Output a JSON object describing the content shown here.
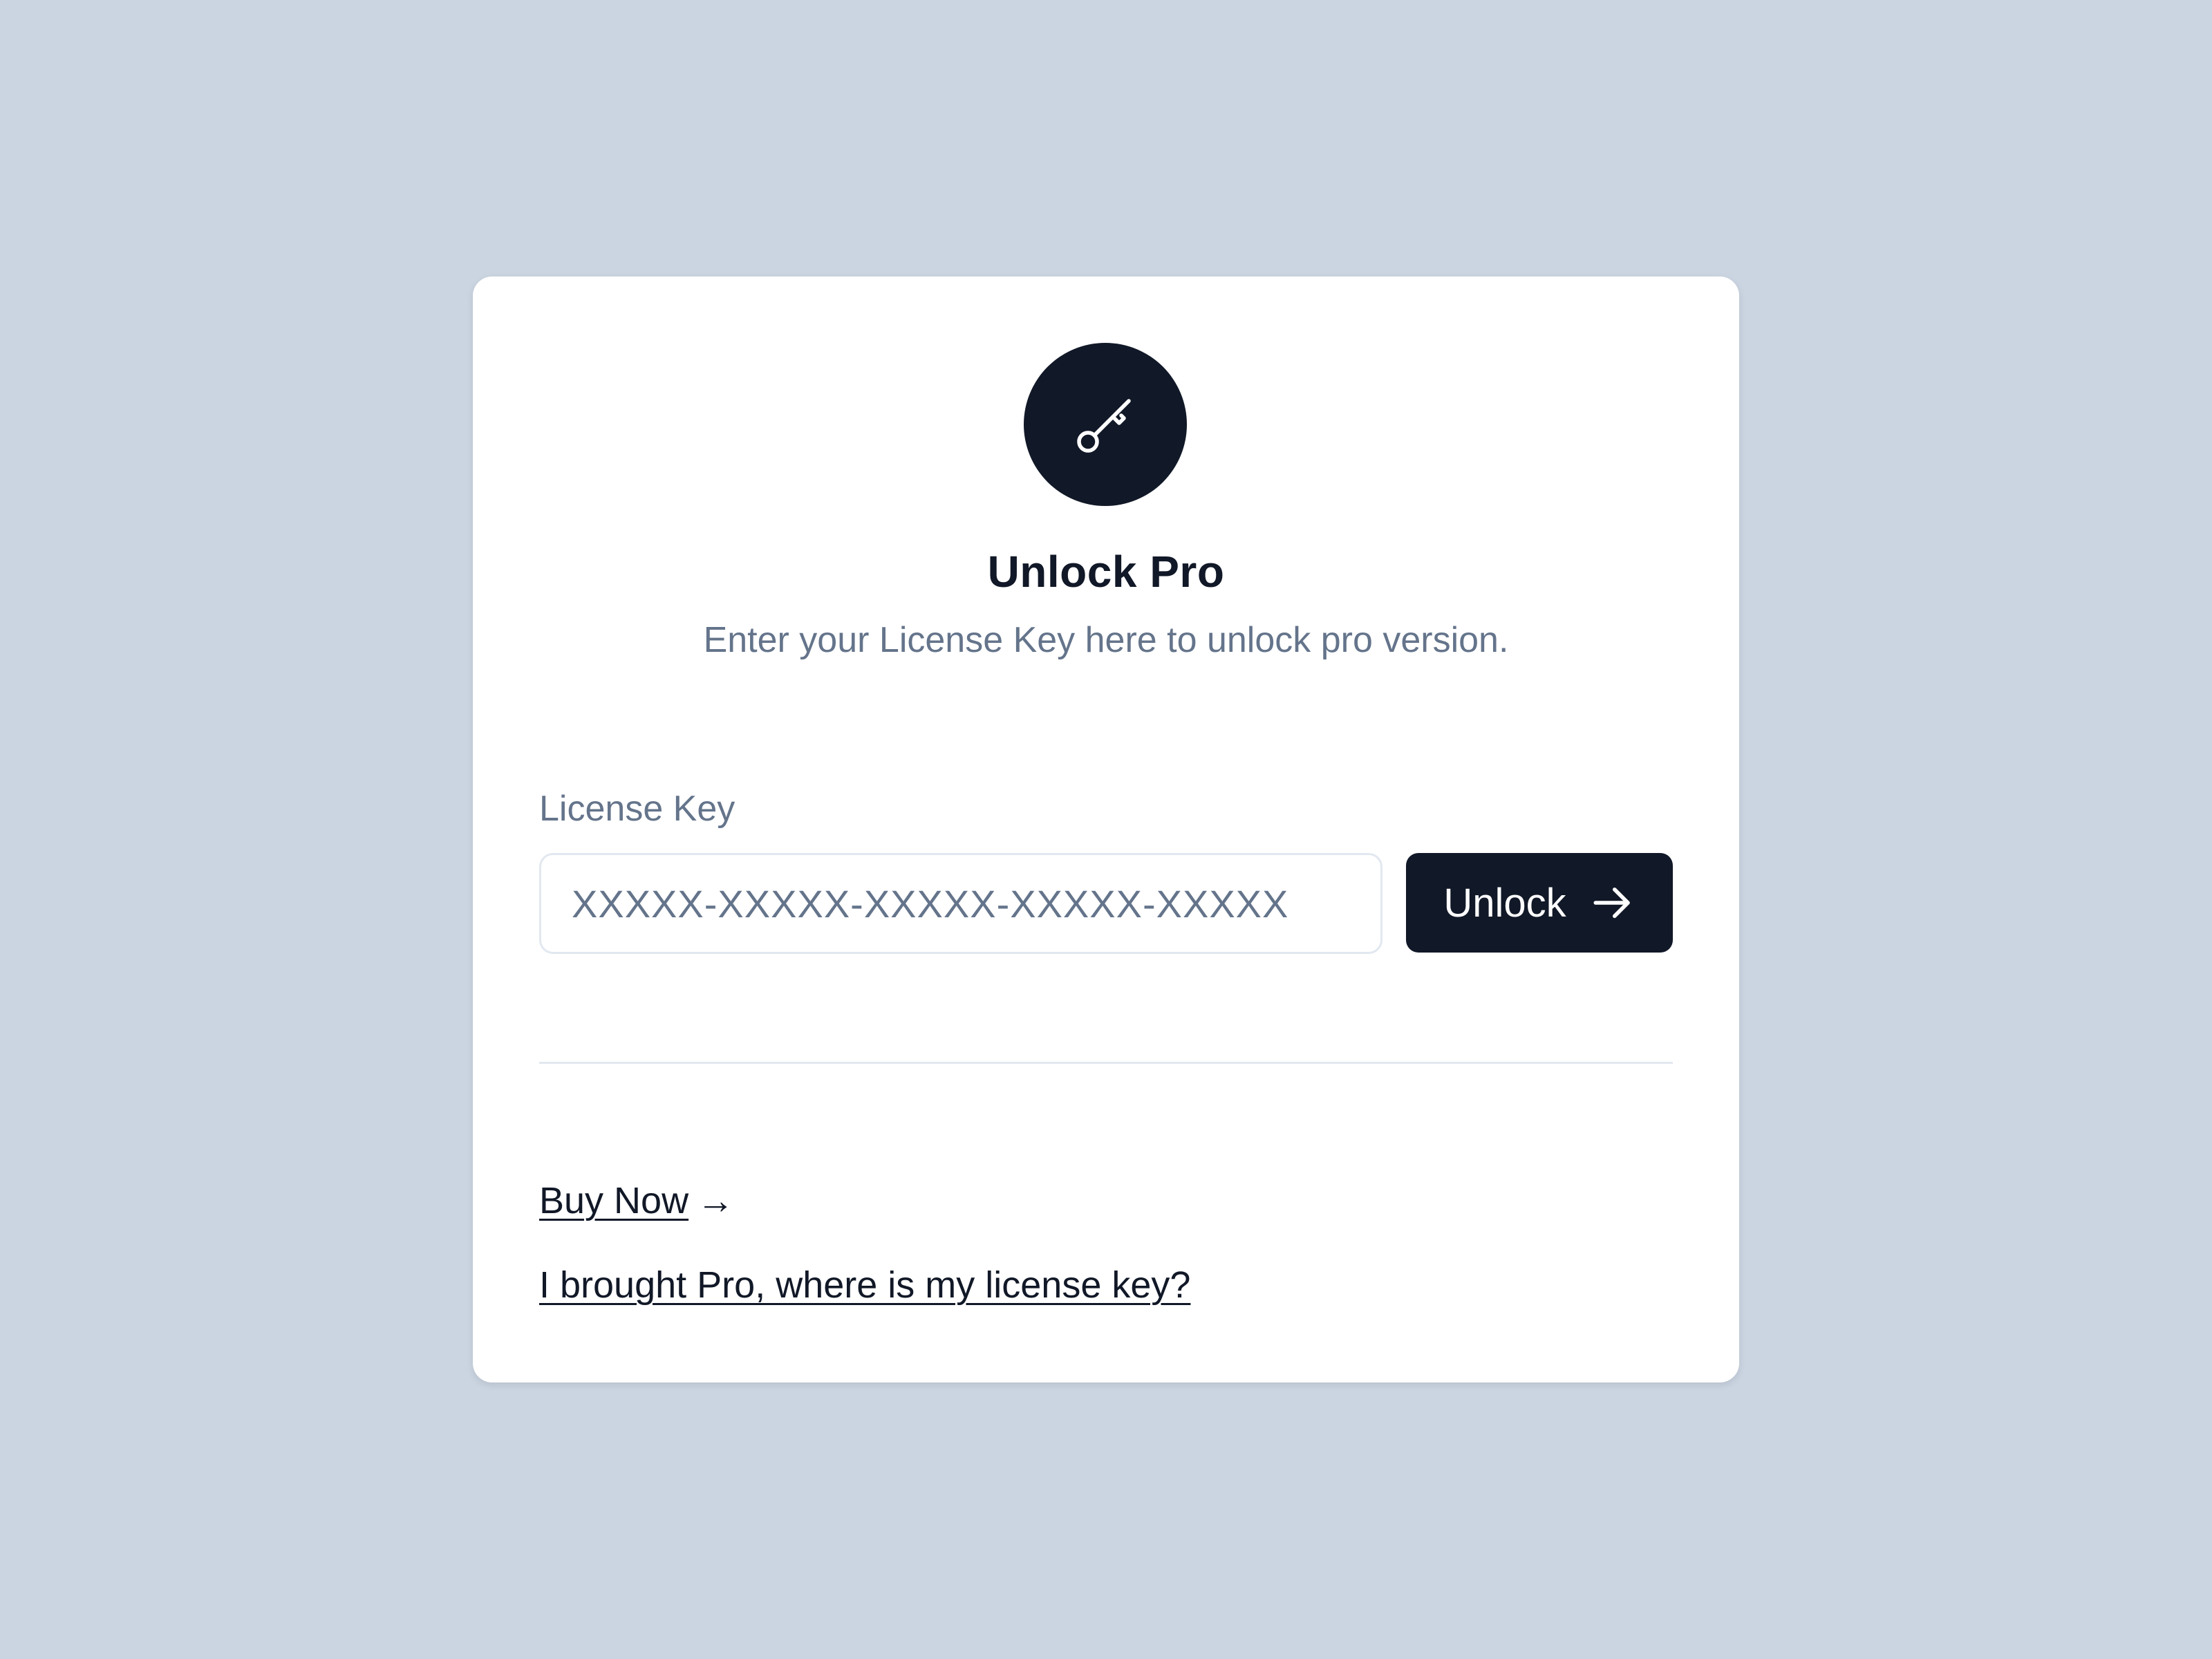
{
  "dialog": {
    "title": "Unlock Pro",
    "subtitle": "Enter your License Key here to unlock pro version.",
    "icon": "key-icon"
  },
  "license": {
    "label": "License Key",
    "placeholder": "XXXXX-XXXXX-XXXXX-XXXXX-XXXXX",
    "value": "",
    "button_label": "Unlock",
    "button_icon": "arrow-right-icon"
  },
  "links": {
    "buy_now": "Buy Now",
    "buy_now_arrow": "→",
    "where_is_key": "I brought Pro, where is my license key?"
  },
  "colors": {
    "background": "#cbd5e1",
    "card": "#ffffff",
    "primary": "#111827",
    "muted_text": "#64748b",
    "border": "#e2e8f0"
  }
}
